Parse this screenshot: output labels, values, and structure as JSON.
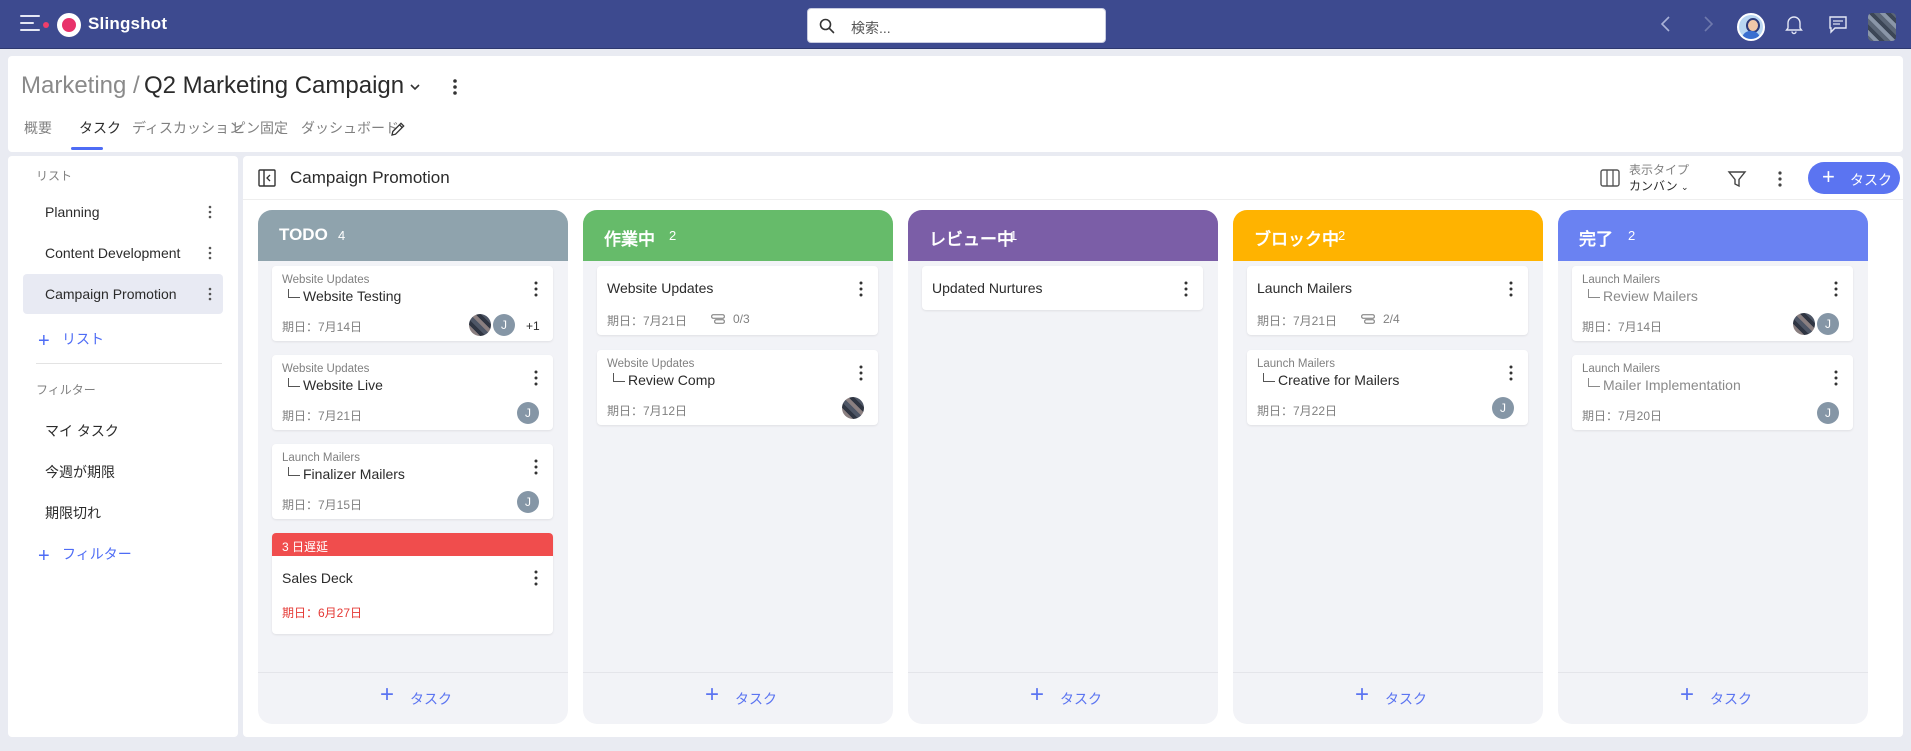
{
  "app": {
    "name": "Slingshot",
    "search_placeholder": "検索..."
  },
  "header": {
    "breadcrumb_parent": "Marketing",
    "separator": "/",
    "title": "Q2 Marketing Campaign",
    "tabs": [
      {
        "label": "概要",
        "active": false
      },
      {
        "label": "タスク",
        "active": true
      },
      {
        "label": "ディスカッション",
        "active": false
      },
      {
        "label": "ピン固定",
        "active": false
      },
      {
        "label": "ダッシュボード",
        "active": false
      }
    ]
  },
  "sidebar": {
    "lists_heading": "リスト",
    "lists": [
      {
        "label": "Planning",
        "active": false
      },
      {
        "label": "Content Development",
        "active": false
      },
      {
        "label": "Campaign Promotion",
        "active": true
      }
    ],
    "add_list": "リスト",
    "filters_heading": "フィルター",
    "filters": [
      "マイ タスク",
      "今週が期限",
      "期限切れ"
    ],
    "add_filter": "フィルター"
  },
  "board": {
    "title": "Campaign Promotion",
    "view_type_label": "表示タイプ",
    "view_type_value": "カンバン",
    "add_task": "タスク",
    "columns": [
      {
        "name": "TODO",
        "count": "4",
        "color": "#8fa3ad",
        "add_label": "タスク",
        "cards": [
          {
            "parent": "Website Updates",
            "title": "Website Testing",
            "due": "期日：7月14日",
            "avatars": [
              "pix",
              "J"
            ],
            "more": "+1"
          },
          {
            "parent": "Website Updates",
            "title": "Website Live",
            "due": "期日：7月21日",
            "avatars": [
              "J"
            ]
          },
          {
            "parent": "Launch Mailers",
            "title": "Finalizer Mailers",
            "due": "期日：7月15日",
            "avatars": [
              "J"
            ]
          },
          {
            "banner": "3 日遅延",
            "title": "Sales Deck",
            "due": "期日：6月27日"
          }
        ]
      },
      {
        "name": "作業中",
        "count": "2",
        "color": "#66bb6a",
        "add_label": "タスク",
        "cards": [
          {
            "title": "Website Updates",
            "due": "期日：7月21日",
            "checklist": "0/3"
          },
          {
            "parent": "Website Updates",
            "title": "Review Comp",
            "due": "期日：7月12日",
            "avatars": [
              "pix"
            ]
          }
        ]
      },
      {
        "name": "レビュー中",
        "count": "1",
        "color": "#7b5ea7",
        "add_label": "タスク",
        "cards": [
          {
            "title": "Updated Nurtures"
          }
        ]
      },
      {
        "name": "ブロック中",
        "count": "2",
        "color": "#ffb300",
        "add_label": "タスク",
        "cards": [
          {
            "title": "Launch Mailers",
            "due": "期日：7月21日",
            "checklist": "2/4"
          },
          {
            "parent": "Launch Mailers",
            "title": "Creative for Mailers",
            "due": "期日：7月22日",
            "avatars": [
              "J"
            ]
          }
        ]
      },
      {
        "name": "完了",
        "count": "2",
        "color": "#6a82f2",
        "add_label": "タスク",
        "cards": [
          {
            "parent": "Launch Mailers",
            "title": "Review Mailers",
            "due": "期日：7月14日",
            "avatars": [
              "pix",
              "J"
            ],
            "done": true
          },
          {
            "parent": "Launch Mailers",
            "title": "Mailer Implementation",
            "due": "期日：7月20日",
            "avatars": [
              "J"
            ],
            "done": true
          }
        ]
      }
    ]
  }
}
